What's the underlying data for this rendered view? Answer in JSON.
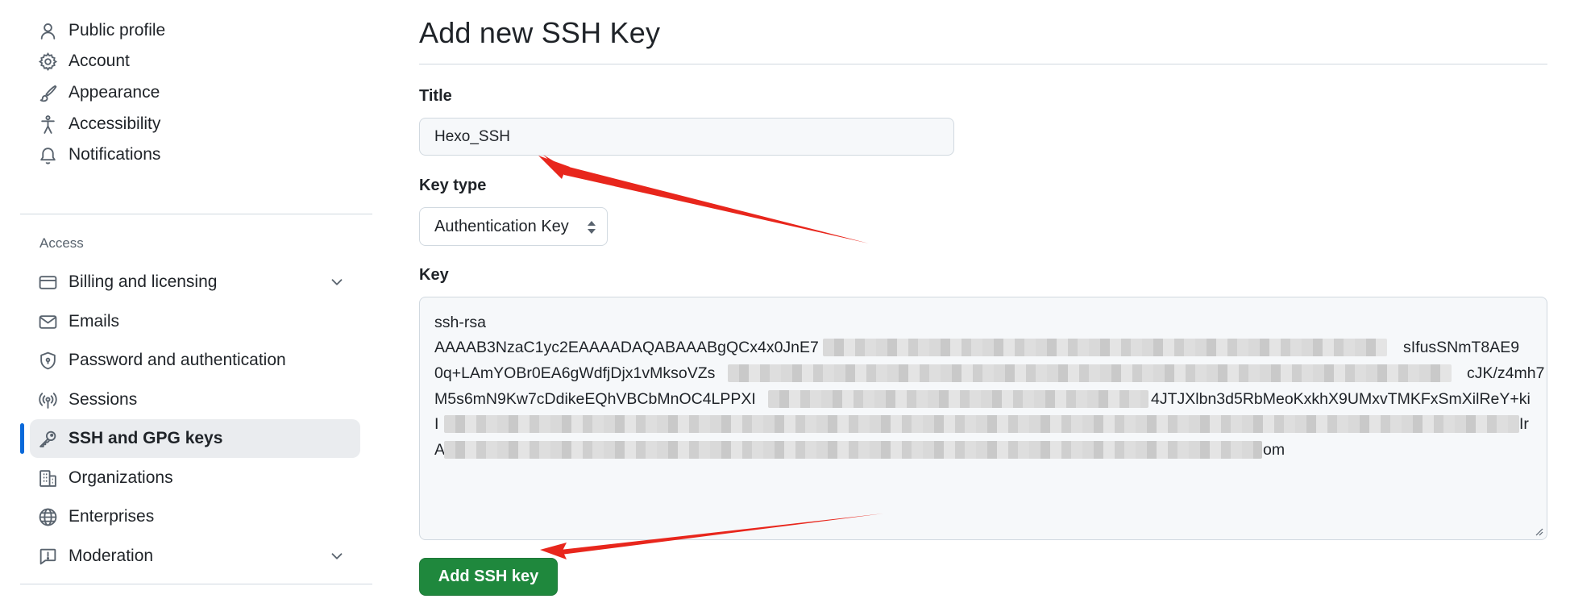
{
  "sidebar": {
    "items_top": [
      {
        "label": "Public profile",
        "icon": "person-icon"
      },
      {
        "label": "Account",
        "icon": "gear-icon"
      },
      {
        "label": "Appearance",
        "icon": "paintbrush-icon"
      },
      {
        "label": "Accessibility",
        "icon": "accessibility-icon"
      },
      {
        "label": "Notifications",
        "icon": "bell-icon"
      }
    ],
    "access_heading": "Access",
    "items_access": [
      {
        "label": "Billing and licensing",
        "icon": "credit-card-icon"
      },
      {
        "label": "Emails",
        "icon": "mail-icon"
      },
      {
        "label": "Password and authentication",
        "icon": "shield-lock-icon"
      },
      {
        "label": "Sessions",
        "icon": "broadcast-icon"
      },
      {
        "label": "SSH and GPG keys",
        "icon": "key-icon"
      },
      {
        "label": "Organizations",
        "icon": "organization-icon"
      },
      {
        "label": "Enterprises",
        "icon": "globe-icon"
      },
      {
        "label": "Moderation",
        "icon": "report-icon"
      }
    ],
    "active_item": "SSH and GPG keys"
  },
  "form": {
    "page_title": "Add new SSH Key",
    "title_label": "Title",
    "title_value": "Hexo_SSH",
    "key_type_label": "Key type",
    "key_type_value": "Authentication Key",
    "key_label": "Key",
    "key_lines": [
      "ssh-rsa",
      "AAAAB3NzaC1yc2EAAAADAQABAAABgQCx4x0JnE7",
      "sIfusSNmT8AE9",
      "0q+LAmYOBr0EA6gWdfjDjx1vMksoVZs",
      "cJK/z4mh7",
      "M5s6mN9Kw7cDdikeEQhVBCbMnOC4LPPXI",
      "4JTJXlbn3d5RbMeoKxkhX9UMxvTMKFxSmXilReY+ki",
      "I",
      "Ir",
      "A",
      "om"
    ],
    "submit_label": "Add SSH key"
  },
  "colors": {
    "accent_blue": "#0969da",
    "submit_green": "#1f883d",
    "annotation_red": "#e8261c"
  }
}
